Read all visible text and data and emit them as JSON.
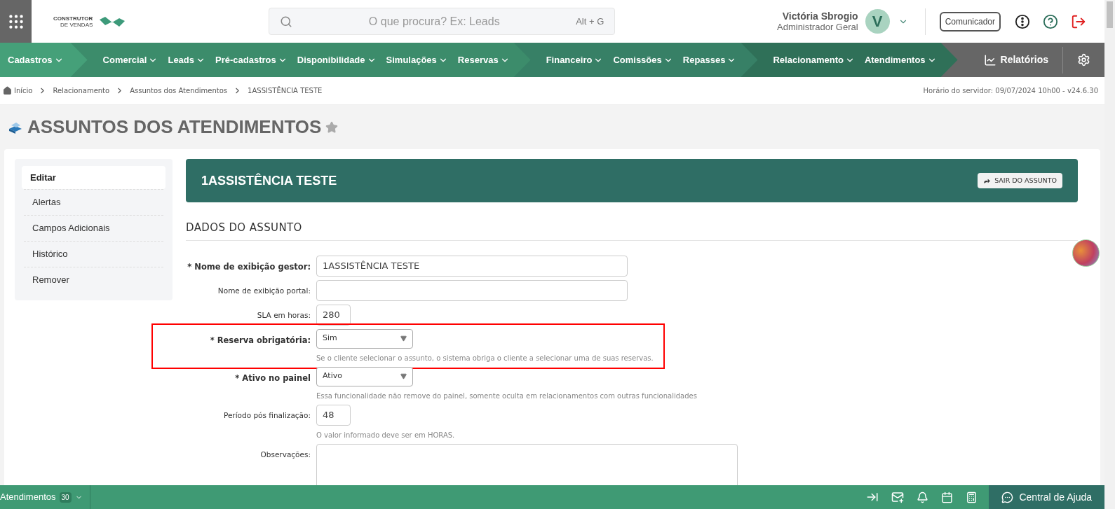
{
  "header": {
    "logo": {
      "line_1": "CONSTRUTOR",
      "line_2": "DE VENDAS"
    },
    "search": {
      "placeholder": "O que procura? Ex: Leads",
      "shortcut": "Alt + G"
    },
    "user": {
      "name": "Victória Sbrogio",
      "role": "Administrador Geral",
      "initial": "V"
    },
    "communicator_button": "Comunicador"
  },
  "nav": {
    "groups": [
      {
        "items": [
          "Cadastros"
        ]
      },
      {
        "items": [
          "Comercial",
          "Leads",
          "Pré-cadastros",
          "Disponibilidade",
          "Simulações",
          "Reservas"
        ]
      },
      {
        "items": [
          "Financeiro",
          "Comissões",
          "Repasses"
        ]
      },
      {
        "items": [
          "Relacionamento",
          "Atendimentos"
        ]
      }
    ],
    "reports": "Relatórios"
  },
  "breadcrumb": {
    "items": [
      "Início",
      "Relacionamento",
      "Assuntos dos Atendimentos",
      "1ASSISTÊNCIA TESTE"
    ],
    "server_time": "Horário do servidor: 09/07/2024 10h00 - v24.6.30"
  },
  "page_title": "ASSUNTOS DOS ATENDIMENTOS",
  "sidebar": {
    "items": [
      {
        "label": "Editar",
        "selected": true
      },
      {
        "label": "Alertas",
        "selected": false
      },
      {
        "label": "Campos Adicionais",
        "selected": false
      },
      {
        "label": "Histórico",
        "selected": false
      },
      {
        "label": "Remover",
        "selected": false
      }
    ]
  },
  "panel": {
    "title": "1ASSISTÊNCIA TESTE",
    "exit_button": "SAIR DO ASSUNTO"
  },
  "section_heading": "DADOS DO ASSUNTO",
  "fields": [
    {
      "kind": "text",
      "label": "* Nome de exibição gestor:",
      "required": true,
      "value": "1ASSISTÊNCIA TESTE",
      "highlighted": false
    },
    {
      "kind": "text",
      "label": "Nome de exibição portal:",
      "required": false,
      "highlighted": false
    },
    {
      "kind": "number",
      "label": "SLA em horas:",
      "required": false,
      "value": "280",
      "highlighted": false
    },
    {
      "kind": "select",
      "label": "* Reserva obrigatória:",
      "required": true,
      "value": "Sim",
      "help": "Se o cliente selecionar o assunto, o sistema obriga o cliente a selecionar uma de suas reservas.",
      "highlighted": true
    },
    {
      "kind": "select",
      "label": "* Ativo no painel",
      "required": true,
      "value": "Ativo",
      "help": "Essa funcionalidade não remove do painel, somente oculta em relacionamentos com outras funcionalidades",
      "highlighted": false
    },
    {
      "kind": "number",
      "label": "Período pós finalização:",
      "required": false,
      "value": "48",
      "help": "O valor informado deve ser em HORAS.",
      "highlighted": false
    },
    {
      "kind": "textarea",
      "label": "Observações:",
      "required": false,
      "highlighted": false
    }
  ],
  "bottom_bar": {
    "label": "Atendimentos",
    "count": "30",
    "help_button": "Central de Ajuda"
  }
}
